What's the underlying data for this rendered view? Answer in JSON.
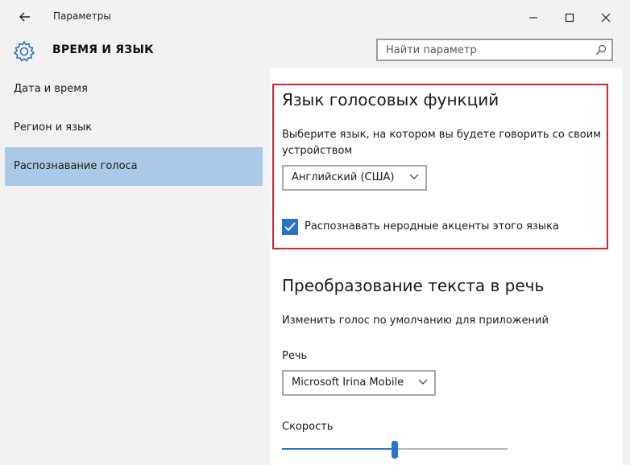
{
  "window": {
    "title": "Параметры",
    "section_title": "ВРЕМЯ И ЯЗЫК"
  },
  "search": {
    "placeholder": "Найти параметр",
    "value": ""
  },
  "sidebar": {
    "items": [
      {
        "label": "Дата и время",
        "selected": false
      },
      {
        "label": "Регион и язык",
        "selected": false
      },
      {
        "label": "Распознавание голоса",
        "selected": true
      }
    ]
  },
  "speech_language": {
    "heading": "Язык голосовых функций",
    "description_line1": "Выберите язык, на котором вы будете говорить со своим",
    "description_line2": "устройством",
    "selected_language": "Английский (США)",
    "accent_checkbox_label": "Распознавать неродные акценты этого языка",
    "accent_checked": true
  },
  "tts": {
    "heading": "Преобразование текста в речь",
    "description": "Изменить голос по умолчанию для приложений",
    "voice_label": "Речь",
    "selected_voice": "Microsoft Irina Mobile",
    "speed_label": "Скорость",
    "speed_fraction": 0.5
  },
  "colors": {
    "accent": "#2b73c6",
    "selected_nav": "#a9c9e6",
    "highlight_border": "#d9222b"
  },
  "icons": [
    "back-arrow-icon",
    "minimize-icon",
    "maximize-icon",
    "close-icon",
    "gear-icon",
    "search-icon",
    "chevron-down-icon",
    "checkmark-icon"
  ]
}
